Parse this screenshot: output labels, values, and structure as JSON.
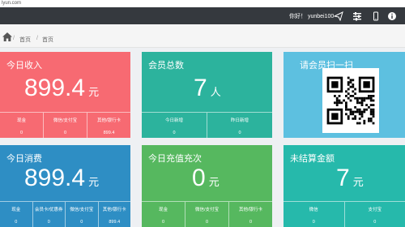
{
  "browser": {
    "url": "lyun.com"
  },
  "topbar": {
    "greeting": "你好！ yunbei100"
  },
  "breadcrumb": {
    "root": "首页",
    "current": "首页"
  },
  "cards": {
    "today_income": {
      "title": "今日收入",
      "value": "899.4",
      "unit": "元",
      "color": "#f76a72",
      "subs": [
        {
          "label": "现金",
          "value": "0"
        },
        {
          "label": "微信/支付宝",
          "value": "0"
        },
        {
          "label": "其他/银行卡",
          "value": "899.4"
        }
      ]
    },
    "members": {
      "title": "会员总数",
      "value": "7",
      "unit": "人",
      "color": "#2cb39d",
      "subs": [
        {
          "label": "今日新增",
          "value": "0"
        },
        {
          "label": "昨日新增",
          "value": "0"
        }
      ]
    },
    "scan": {
      "title": "请会员扫一扫",
      "color": "#5dc0e0"
    },
    "today_spend": {
      "title": "今日消费",
      "value": "899.4",
      "unit": "元",
      "color": "#2e8ec4",
      "subs": [
        {
          "label": "现金",
          "value": "0"
        },
        {
          "label": "会员卡/优惠券",
          "value": "0"
        },
        {
          "label": "微信/支付宝",
          "value": "0"
        },
        {
          "label": "其他/银行卡",
          "value": "899.4"
        }
      ]
    },
    "today_recharge": {
      "title": "今日充值充次",
      "value": "0",
      "unit": "元",
      "color": "#56b85f",
      "subs": [
        {
          "label": "现金",
          "value": "0"
        },
        {
          "label": "微信/支付宝",
          "value": "0"
        },
        {
          "label": "其他/银行卡",
          "value": "0"
        }
      ]
    },
    "unsettled": {
      "title": "未结算金额",
      "value": "7",
      "unit": "元",
      "color": "#26b9ab",
      "subs": [
        {
          "label": "微信",
          "value": "0"
        },
        {
          "label": "支付宝",
          "value": "0"
        }
      ]
    }
  }
}
